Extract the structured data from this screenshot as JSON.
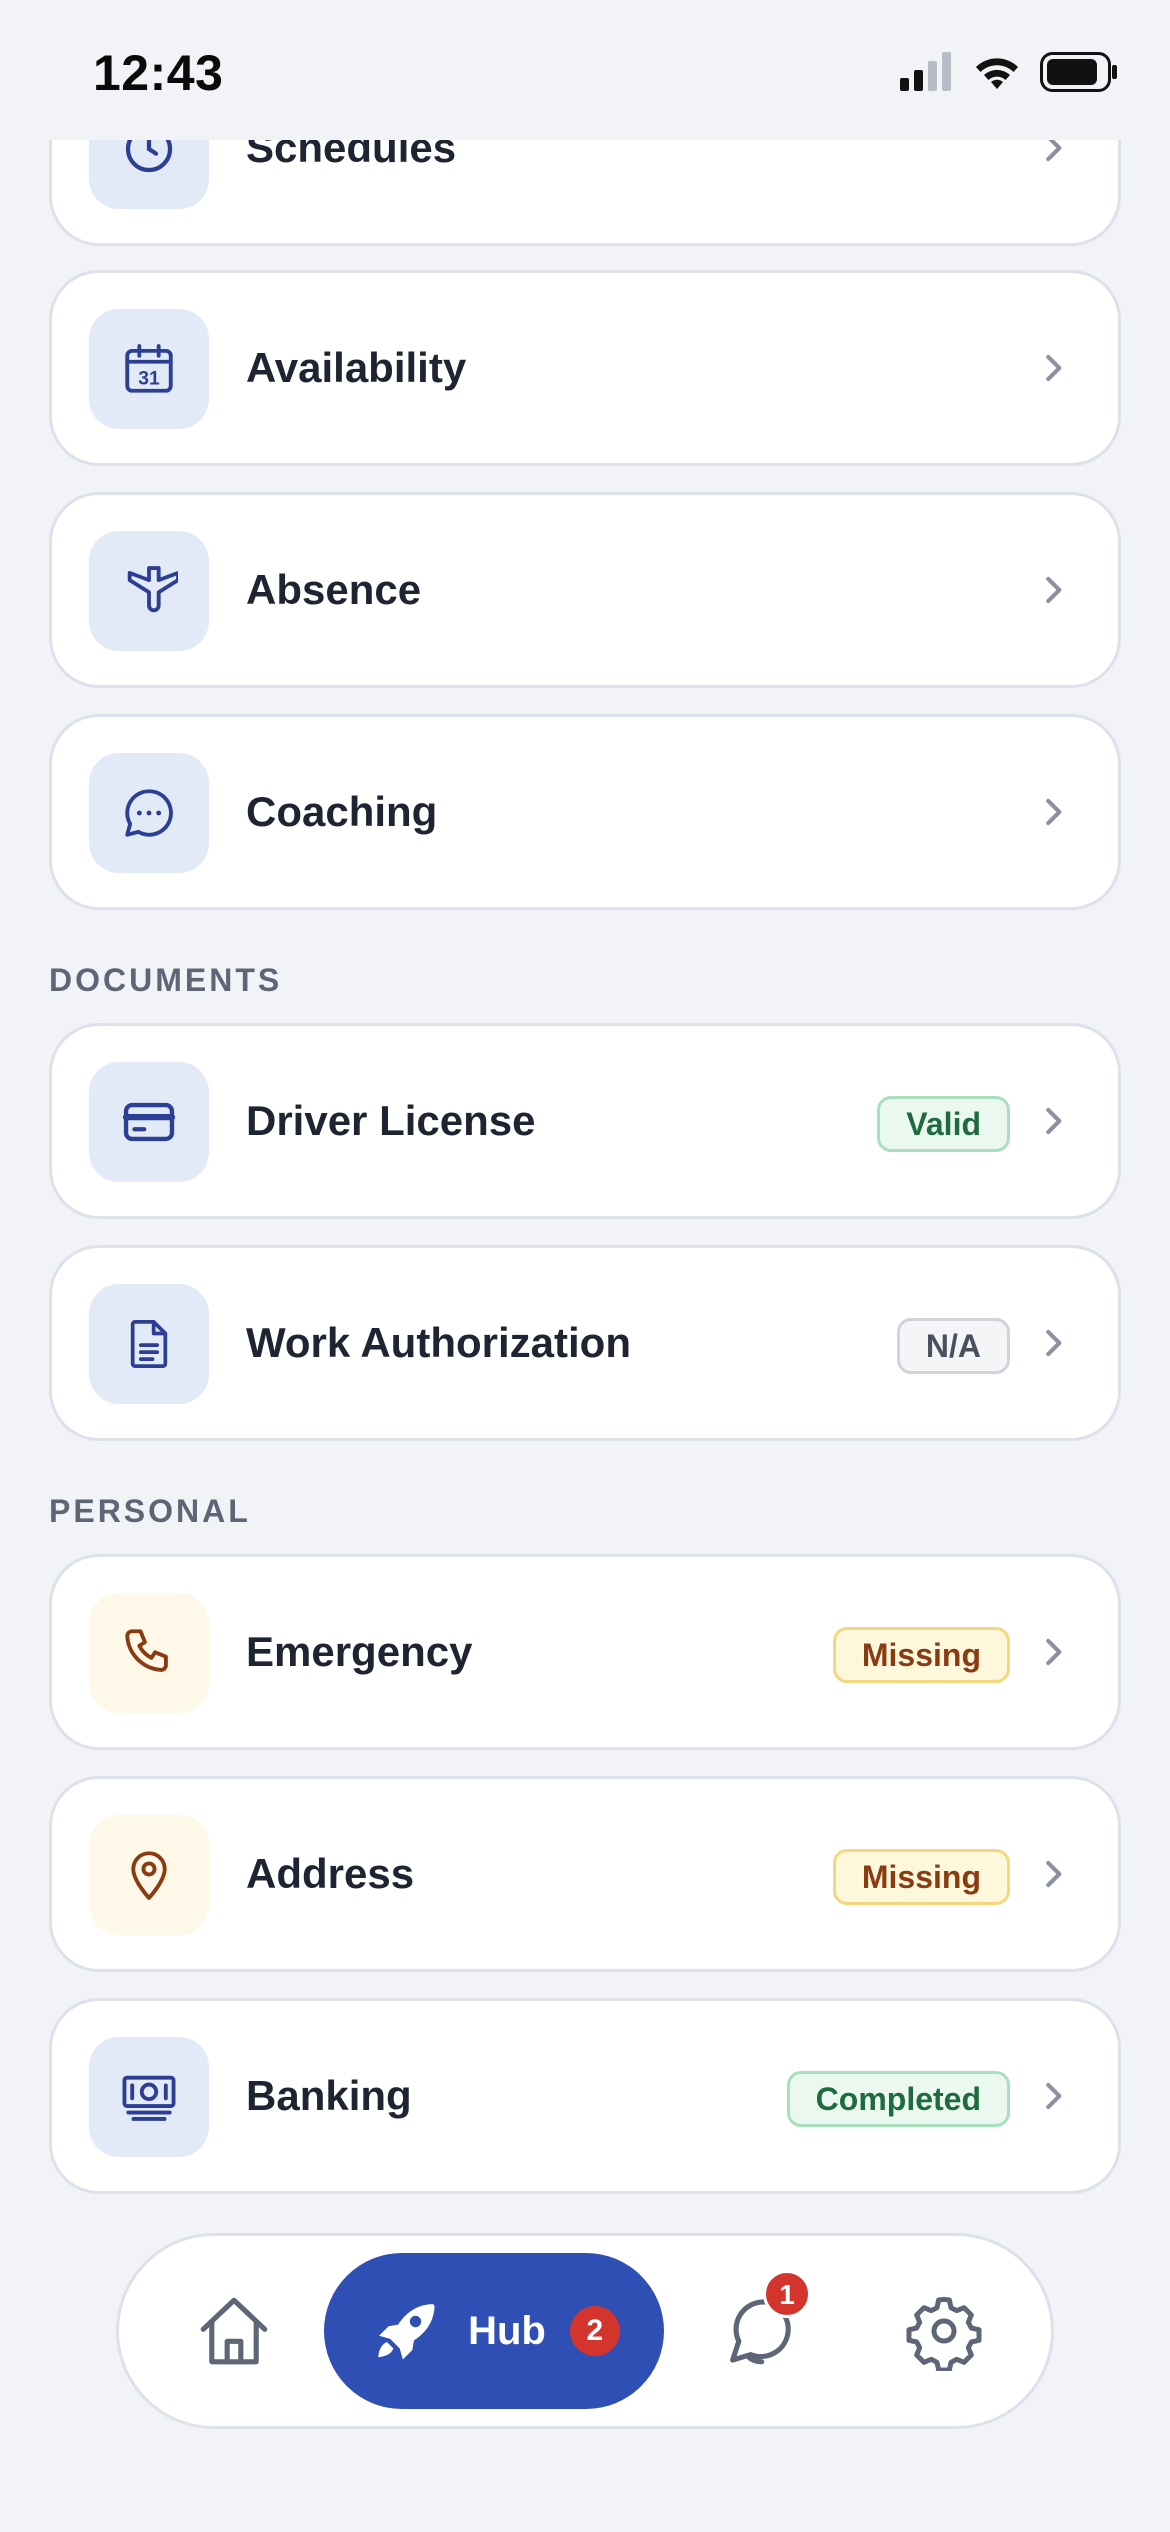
{
  "status_bar": {
    "time": "12:43"
  },
  "schedule_rows": [
    {
      "label": "Schedules",
      "icon": "clock-icon"
    },
    {
      "label": "Availability",
      "icon": "calendar-icon",
      "icon_text": "31"
    },
    {
      "label": "Absence",
      "icon": "plane-icon"
    },
    {
      "label": "Coaching",
      "icon": "chat-bubble-icon"
    }
  ],
  "documents": {
    "title": "DOCUMENTS",
    "rows": [
      {
        "label": "Driver License",
        "icon": "card-icon",
        "badge": "Valid",
        "badge_color": "#1f6b3e"
      },
      {
        "label": "Work Authorization",
        "icon": "document-icon",
        "badge": "N/A",
        "badge_color": "#4a505c"
      }
    ]
  },
  "personal": {
    "title": "PERSONAL",
    "rows": [
      {
        "label": "Emergency",
        "icon": "phone-icon",
        "badge": "Missing",
        "badge_color": "#8a3b12"
      },
      {
        "label": "Address",
        "icon": "location-pin-icon",
        "badge": "Missing",
        "badge_color": "#8a3b12"
      },
      {
        "label": "Banking",
        "icon": "cash-icon",
        "badge": "Completed",
        "badge_color": "#1f6b3e"
      }
    ]
  },
  "tab_bar": {
    "items": [
      {
        "name": "home",
        "icon": "home-icon"
      },
      {
        "name": "hub",
        "icon": "rocket-icon",
        "label": "Hub",
        "count": "2",
        "active": true
      },
      {
        "name": "messages",
        "icon": "chat-icon",
        "count": "1"
      },
      {
        "name": "settings",
        "icon": "gear-icon"
      }
    ]
  },
  "colors": {
    "accent": "#2f4fb5",
    "icon_blue": "#2c3f94",
    "icon_brown": "#8a3b12",
    "notification": "#d3342c"
  }
}
